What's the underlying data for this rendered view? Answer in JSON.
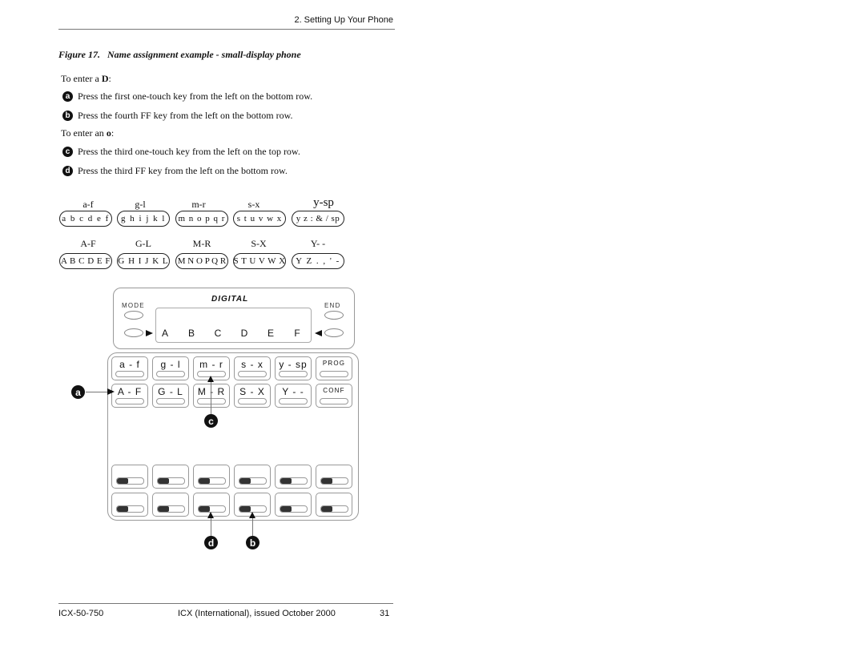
{
  "header": {
    "section": "2. Setting Up Your Phone"
  },
  "figure": {
    "caption": "Figure 17.   Name assignment example - small-display phone"
  },
  "instructions": {
    "enter_d": {
      "prefix": "To enter a ",
      "letter": "D",
      "suffix": ":"
    },
    "enter_o": {
      "prefix": "To enter an ",
      "letter": "o",
      "suffix": ":"
    },
    "steps": [
      {
        "badge": "a",
        "text": "Press the first one-touch key from the left on the bottom row."
      },
      {
        "badge": "b",
        "text": "Press the fourth FF key from the left on the bottom row."
      },
      {
        "badge": "c",
        "text": "Press the third one-touch key from the left on the top row."
      },
      {
        "badge": "d",
        "text": "Press the third FF key from the left on the bottom row."
      }
    ]
  },
  "letter_groups": {
    "lowercase": [
      {
        "label": "a-f",
        "chars": "a b c d e f"
      },
      {
        "label": "g-l",
        "chars": "g h i j k l"
      },
      {
        "label": "m-r",
        "chars": "m n o p q r"
      },
      {
        "label": "s-x",
        "chars": "s t u v w x"
      },
      {
        "label": "y-sp",
        "chars": "y z : & / sp"
      }
    ],
    "uppercase": [
      {
        "label": "A-F",
        "chars": "A B C D E F"
      },
      {
        "label": "G-L",
        "chars": "G H I J K L"
      },
      {
        "label": "M-R",
        "chars": "M N O P Q R"
      },
      {
        "label": "S-X",
        "chars": "S T U V W X"
      },
      {
        "label": "Y- -",
        "chars": "Y Z . , ' -"
      }
    ]
  },
  "phone": {
    "brand": "DIGITAL",
    "mode_label": "MODE",
    "end_label": "END",
    "display_chars": [
      "A",
      "B",
      "C",
      "D",
      "E",
      "F"
    ],
    "one_touch_top": [
      "a - f",
      "g - l",
      "m - r",
      "s - x",
      "y - sp",
      "PROG"
    ],
    "one_touch_bottom": [
      "A - F",
      "G - L",
      "M - R",
      "S - X",
      "Y - -",
      "CONF"
    ],
    "ff_rows": 2,
    "ff_columns": 6
  },
  "callouts": {
    "a": "a",
    "b": "b",
    "c": "c",
    "d": "d"
  },
  "footer": {
    "doc_id": "ICX-50-750",
    "issue": "ICX (International), issued October 2000",
    "page": "31"
  }
}
